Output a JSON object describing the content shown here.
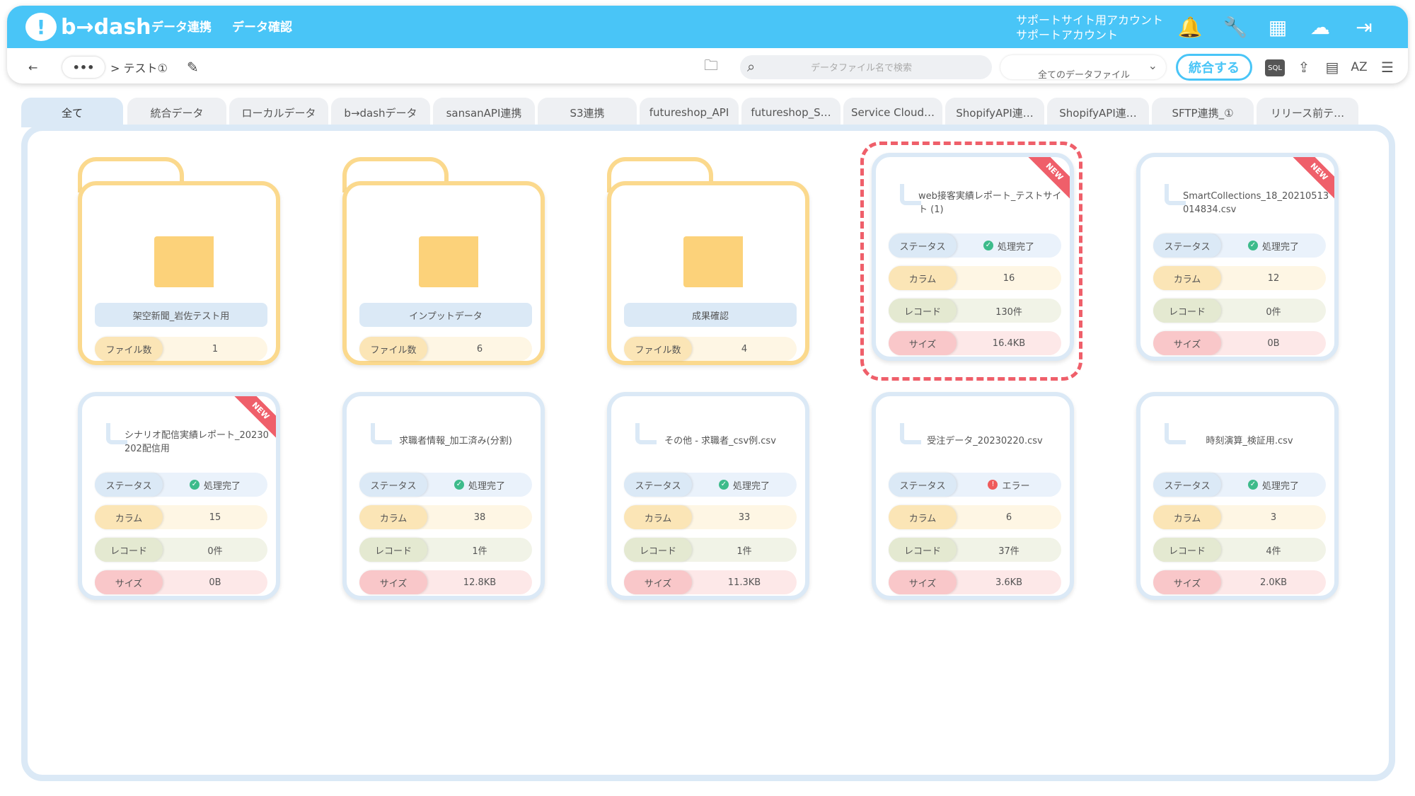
{
  "header": {
    "logo": "b→dash",
    "nav": [
      "データ連携",
      "データ確認"
    ],
    "account": [
      "サポートサイト用アカウント",
      "サポートアカウント"
    ],
    "icons": [
      "bell-icon",
      "wrench-icon",
      "grid-icon",
      "support-chat-icon",
      "logout-icon"
    ],
    "accent": "#49c5f7"
  },
  "toolbar": {
    "breadcrumb_more": "•••",
    "breadcrumb_current": "> テスト①",
    "search_placeholder": "データファイル名で検索",
    "filter_value": "全てのデータファイル",
    "merge_label": "統合する",
    "sql_label": "SQL",
    "sort_label": "AZ"
  },
  "tabs": [
    "全て",
    "統合データ",
    "ローカルデータ",
    "b→dashデータ",
    "sansanAPI連携",
    "S3連携",
    "futureshop_API",
    "futureshop_S…",
    "Service Cloud…",
    "ShopifyAPI連…",
    "ShopifyAPI連…",
    "SFTP連携_①",
    "リリース前テ…"
  ],
  "labels": {
    "file_count": "ファイル数",
    "status": "ステータス",
    "column": "カラム",
    "record": "レコード",
    "size": "サイズ",
    "new_badge": "NEW"
  },
  "folders": [
    {
      "name": "架空新聞_岩佐テスト用",
      "count": "1"
    },
    {
      "name": "インプットデータ",
      "count": "6"
    },
    {
      "name": "成果確認",
      "count": "4"
    }
  ],
  "files": [
    {
      "title": "web接客実績レポート_テストサイト (1)",
      "status": "処理完了",
      "status_ok": true,
      "columns": "16",
      "records": "130件",
      "size": "16.4KB",
      "new": true,
      "selected": true
    },
    {
      "title": "SmartCollections_18_20210513014834.csv",
      "status": "処理完了",
      "status_ok": true,
      "columns": "12",
      "records": "0件",
      "size": "0B",
      "new": true,
      "selected": false
    },
    {
      "title": "シナリオ配信実績レポート_20230202配信用",
      "status": "処理完了",
      "status_ok": true,
      "columns": "15",
      "records": "0件",
      "size": "0B",
      "new": true,
      "selected": false
    },
    {
      "title": "求職者情報_加工済み(分割)",
      "status": "処理完了",
      "status_ok": true,
      "columns": "38",
      "records": "1件",
      "size": "12.8KB",
      "new": false,
      "selected": false
    },
    {
      "title": "その他 - 求職者_csv例.csv",
      "status": "処理完了",
      "status_ok": true,
      "columns": "33",
      "records": "1件",
      "size": "11.3KB",
      "new": false,
      "selected": false
    },
    {
      "title": "受注データ_20230220.csv",
      "status": "エラー",
      "status_ok": false,
      "columns": "6",
      "records": "37件",
      "size": "3.6KB",
      "new": false,
      "selected": false
    },
    {
      "title": "時刻演算_検証用.csv",
      "status": "処理完了",
      "status_ok": true,
      "columns": "3",
      "records": "4件",
      "size": "2.0KB",
      "new": false,
      "selected": false
    }
  ]
}
